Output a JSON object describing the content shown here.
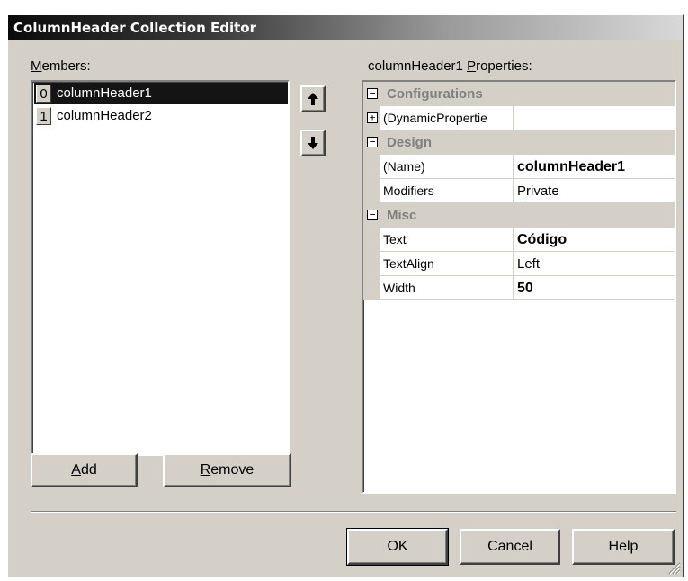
{
  "window": {
    "title": "ColumnHeader Collection Editor"
  },
  "members": {
    "label_pre": "",
    "label_key": "M",
    "label_post": "embers:",
    "items": [
      {
        "index": "0",
        "name": "columnHeader1",
        "selected": true
      },
      {
        "index": "1",
        "name": "columnHeader2",
        "selected": false
      }
    ],
    "move_up_glyph": "🡅",
    "move_down_glyph": "🡇"
  },
  "buttons": {
    "add_key": "A",
    "add_rest": "dd",
    "remove_key": "R",
    "remove_rest": "emove",
    "ok": "OK",
    "cancel": "Cancel",
    "help": "Help"
  },
  "properties": {
    "label_pre": "columnHeader1 ",
    "label_key": "P",
    "label_post": "roperties:",
    "rows": [
      {
        "kind": "category",
        "name": "Configurations",
        "expander": "⊟"
      },
      {
        "kind": "property",
        "name": "(DynamicPropertie",
        "value": "",
        "bold": false,
        "expander": "⊞"
      },
      {
        "kind": "category",
        "name": "Design",
        "expander": "⊟"
      },
      {
        "kind": "property",
        "name": "(Name)",
        "value": "columnHeader1",
        "bold": true
      },
      {
        "kind": "property",
        "name": "Modifiers",
        "value": "Private",
        "bold": false
      },
      {
        "kind": "category",
        "name": "Misc",
        "expander": "⊟"
      },
      {
        "kind": "property",
        "name": "Text",
        "value": "Código",
        "bold": true
      },
      {
        "kind": "property",
        "name": "TextAlign",
        "value": "Left",
        "bold": false
      },
      {
        "kind": "property",
        "name": "Width",
        "value": "50",
        "bold": true
      }
    ]
  },
  "colors": {
    "selection": "#141414",
    "face": "#d4d0c8",
    "category_text": "#808080"
  },
  "icons": {
    "expanded": "minus-box-icon",
    "collapsed": "plus-box-icon",
    "grip": "resize-grip-icon"
  }
}
